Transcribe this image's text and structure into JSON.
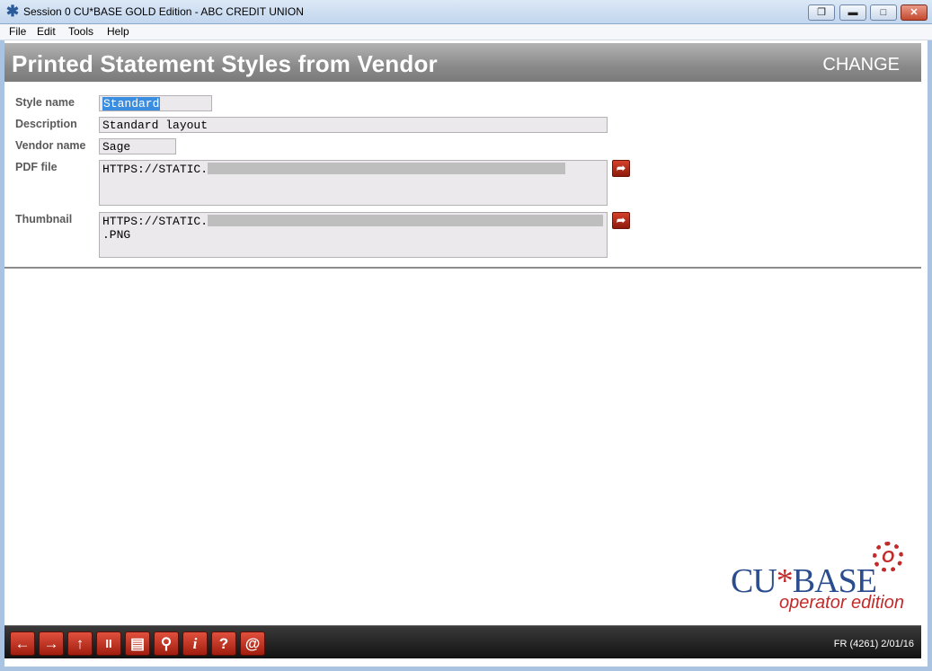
{
  "window": {
    "title": "Session 0 CU*BASE GOLD Edition - ABC CREDIT UNION",
    "restore_icon": "restore-icon",
    "minimize_icon": "minimize-icon",
    "maximize_icon": "maximize-icon",
    "close_icon": "close-icon"
  },
  "menu": {
    "file": "File",
    "edit": "Edit",
    "tools": "Tools",
    "help": "Help"
  },
  "header": {
    "title": "Printed Statement Styles from Vendor",
    "mode": "CHANGE"
  },
  "form": {
    "style_name": {
      "label": "Style name",
      "value": "Standard"
    },
    "description": {
      "label": "Description",
      "value": "Standard layout"
    },
    "vendor_name": {
      "label": "Vendor name",
      "value": "Sage"
    },
    "pdf_file": {
      "label": "PDF file",
      "value": "HTTPS://STATIC."
    },
    "thumbnail": {
      "label": "Thumbnail",
      "value_line1": "HTTPS://STATIC.",
      "value_line2": ".PNG"
    }
  },
  "logo": {
    "brand_cu": "CU",
    "brand_star": "*",
    "brand_base": "BASE",
    "edition": "operator edition",
    "gear_letter": "O"
  },
  "toolbar": {
    "buttons": [
      {
        "icon": "back-arrow-icon",
        "glyph": "←"
      },
      {
        "icon": "forward-arrow-icon",
        "glyph": "→"
      },
      {
        "icon": "up-arrow-icon",
        "glyph": "↑"
      },
      {
        "icon": "pause-icon",
        "glyph": "II"
      },
      {
        "icon": "print-icon",
        "glyph": "▤"
      },
      {
        "icon": "link-icon",
        "glyph": "⚲"
      },
      {
        "icon": "info-icon",
        "glyph": "i"
      },
      {
        "icon": "help-icon",
        "glyph": "?"
      },
      {
        "icon": "at-icon",
        "glyph": "@"
      }
    ],
    "status": "FR (4261) 2/01/16"
  },
  "colors": {
    "accent_red": "#c32a2a",
    "header_gray": "#8a8a8a",
    "brand_blue": "#2b4d8e"
  }
}
